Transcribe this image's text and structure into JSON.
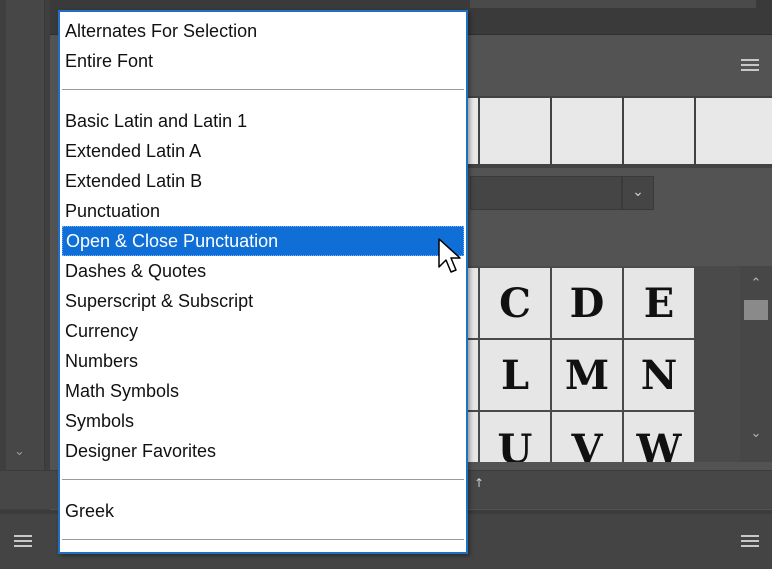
{
  "menu": {
    "items": [
      {
        "label": "Alternates For Selection"
      },
      {
        "label": "Entire Font"
      },
      {
        "label": "Basic Latin and Latin 1"
      },
      {
        "label": "Extended Latin A"
      },
      {
        "label": "Extended Latin B"
      },
      {
        "label": "Punctuation"
      },
      {
        "label": "Open & Close Punctuation",
        "selected": true
      },
      {
        "label": "Dashes & Quotes"
      },
      {
        "label": "Superscript & Subscript"
      },
      {
        "label": "Currency"
      },
      {
        "label": "Numbers"
      },
      {
        "label": "Math Symbols"
      },
      {
        "label": "Symbols"
      },
      {
        "label": "Designer Favorites"
      },
      {
        "label": "Greek"
      }
    ]
  },
  "glyphs": {
    "row1": [
      "C",
      "D",
      "E"
    ],
    "row2": [
      "L",
      "M",
      "N"
    ],
    "row3": [
      "U",
      "V",
      "W"
    ]
  },
  "colors": {
    "selection": "#0f6fd6",
    "menu_border": "#1f6fc4",
    "panel_bg": "#535353"
  },
  "icons": {
    "panel_menu": "hamburger-icon",
    "dropdown": "chevron-down-icon",
    "scroll_up": "chevron-up-icon",
    "scroll_down": "chevron-down-icon",
    "cursor": "arrow-cursor-icon"
  }
}
